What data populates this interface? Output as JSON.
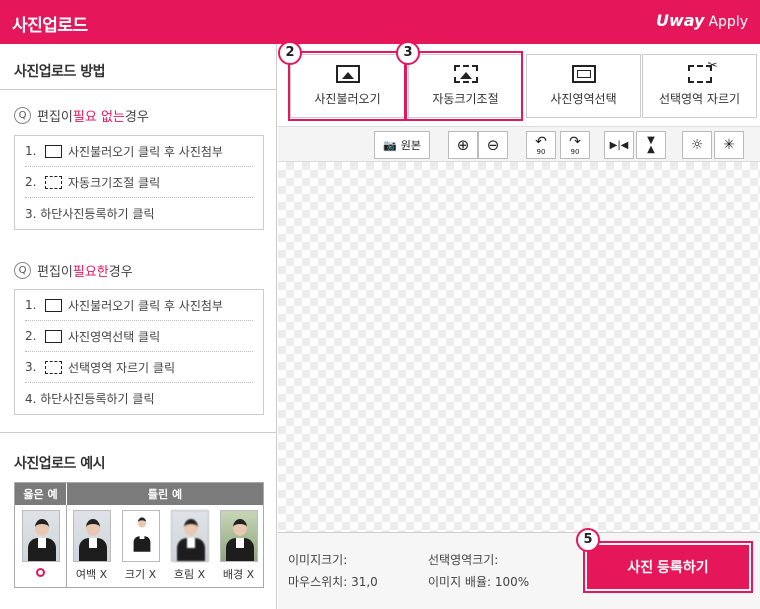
{
  "header": {
    "title": "사진업로드",
    "logo": "Uway",
    "logo_suffix": "Apply"
  },
  "guide": {
    "title": "사진업로드 방법",
    "case1": {
      "badge": "Q",
      "pre": "편집이 ",
      "highlight": "필요 없는",
      "post": " 경우",
      "steps": [
        {
          "num": "1.",
          "text": "사진불러오기 클릭 후 사진첨부"
        },
        {
          "num": "2.",
          "text": "자동크기조절 클릭"
        },
        {
          "num": "",
          "text": "3. 하단사진등록하기 클릭"
        }
      ]
    },
    "case2": {
      "badge": "Q",
      "pre": "편집이 ",
      "highlight": "필요한",
      "post": " 경우",
      "steps": [
        {
          "num": "1.",
          "text": "사진불러오기 클릭 후 사진첨부"
        },
        {
          "num": "2.",
          "text": "사진영역선택 클릭"
        },
        {
          "num": "3.",
          "text": "선택영역 자르기 클릭"
        },
        {
          "num": "",
          "text": "4. 하단사진등록하기 클릭"
        }
      ]
    }
  },
  "examples": {
    "title": "사진업로드 예시",
    "good_header": "옳은 예",
    "bad_header": "틀린 예",
    "good_mark": "O",
    "bad": [
      {
        "caption": "여백 X"
      },
      {
        "caption": "크기 X"
      },
      {
        "caption": "흐림 X"
      },
      {
        "caption": "배경 X"
      }
    ]
  },
  "tools": {
    "load": "사진불러오기",
    "auto_resize": "자동크기조절",
    "select_area": "사진영역선택",
    "crop": "선택영역 자르기",
    "badges": [
      "2",
      "3",
      "5"
    ]
  },
  "toolbar": {
    "original": "원본",
    "rotate_left_sub": "90",
    "rotate_right_sub": "90"
  },
  "footer": {
    "image_size_label": "이미지크기:",
    "selection_size_label": "선택영역크기:",
    "mouse_pos_label": "마우스위치:",
    "mouse_pos_value": "31,0",
    "zoom_label": "이미지 배율:",
    "zoom_value": "100%",
    "register": "사진 등록하기"
  },
  "colors": {
    "accent": "#e5175a"
  }
}
